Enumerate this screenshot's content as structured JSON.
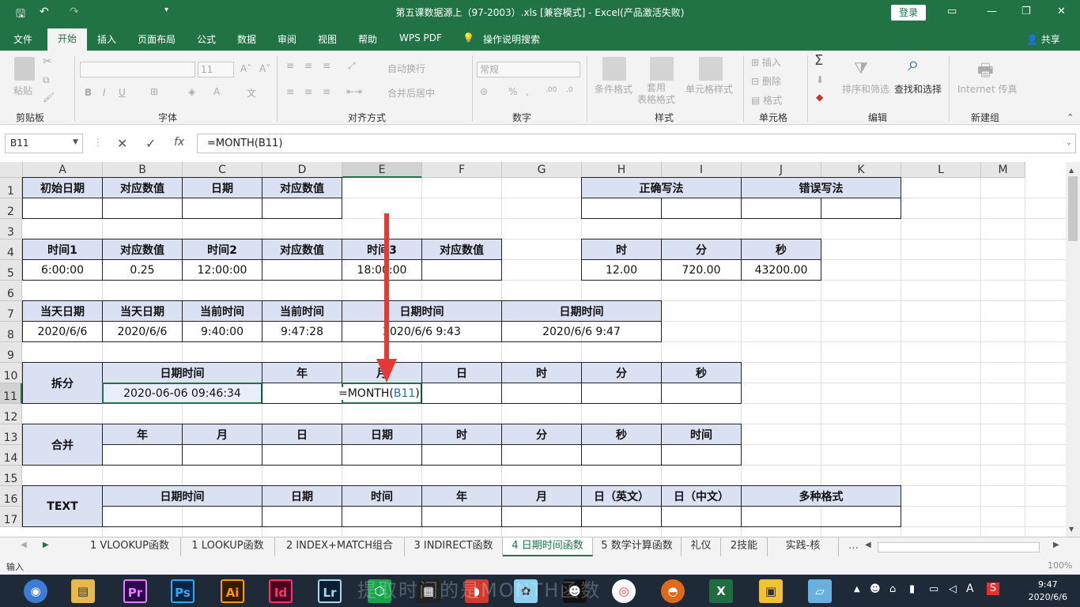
{
  "title_bar": {
    "title": "第五课数据源上（97-2003）.xls  [兼容模式]  -  Excel(产品激活失败)",
    "login": "登录"
  },
  "menu": [
    "文件",
    "开始",
    "插入",
    "页面布局",
    "公式",
    "数据",
    "审阅",
    "视图",
    "帮助",
    "WPS PDF",
    "操作说明搜索",
    "共享"
  ],
  "ribbon": {
    "groups": [
      "剪贴板",
      "字体",
      "对齐方式",
      "数字",
      "样式",
      "单元格",
      "编辑",
      "新建组"
    ],
    "paste": "粘贴",
    "font_size": "11",
    "wrap": "自动换行",
    "merge": "合并后居中",
    "number_format": "常规",
    "cond_format": "条件格式",
    "table_format": "套用\n表格格式",
    "cell_styles": "单元格样式",
    "insert": "插入",
    "delete": "删除",
    "format": "格式",
    "sort_filter": "排序和筛选",
    "find_select": "查找和选择",
    "internet": "Internet 传真"
  },
  "formula_bar": {
    "name_box": "B11",
    "formula": "=MONTH(B11)"
  },
  "columns": [
    "A",
    "B",
    "C",
    "D",
    "E",
    "F",
    "G",
    "H",
    "I",
    "J",
    "K",
    "L",
    "M"
  ],
  "rows": [
    "1",
    "2",
    "3",
    "4",
    "5",
    "6",
    "7",
    "8",
    "9",
    "10",
    "11",
    "12",
    "13",
    "14",
    "15",
    "16",
    "17"
  ],
  "cells": {
    "r1": [
      "初始日期",
      "对应数值",
      "日期",
      "对应数值",
      "正确写法",
      "错误写法"
    ],
    "r4": [
      "时间1",
      "对应数值",
      "时间2",
      "对应数值",
      "时间3",
      "对应数值",
      "时",
      "分",
      "秒"
    ],
    "r5": [
      "6:00:00",
      "0.25",
      "12:00:00",
      "18:00:00",
      "12.00",
      "720.00",
      "43200.00"
    ],
    "r7": [
      "当天日期",
      "当天日期",
      "当前时间",
      "当前时间",
      "日期时间",
      "日期时间"
    ],
    "r8": [
      "2020/6/6",
      "2020/6/6",
      "9:40:00",
      "9:47:28",
      "2020/6/6 9:43",
      "2020/6/6 9:47"
    ],
    "split_label": "拆分",
    "r10": [
      "日期时间",
      "年",
      "月",
      "日",
      "时",
      "分",
      "秒"
    ],
    "r11": [
      "2020-06-06 09:46:34",
      "=MONTH(",
      "B11",
      ")"
    ],
    "merge_label": "合并",
    "r13": [
      "年",
      "月",
      "日",
      "日期",
      "时",
      "分",
      "秒",
      "时间"
    ],
    "text_label": "TEXT",
    "r16": [
      "日期时间",
      "日期",
      "时间",
      "年",
      "月",
      "日（英文）",
      "日（中文）",
      "多种格式"
    ]
  },
  "sheet_tabs": [
    "1 VLOOKUP函数",
    "1 LOOKUP函数",
    "2 INDEX+MATCH组合",
    "3 INDIRECT函数",
    "4 日期时间函数",
    "5 数学计算函数",
    "礼仪",
    "2技能",
    "实践-核"
  ],
  "active_tab": "4 日期时间函数",
  "status": {
    "mode": "输入",
    "zoom": "100%"
  },
  "taskbar": {
    "time": "9:47",
    "date": "2020/6/6"
  },
  "watermark": "提取时间的是MONTH函数"
}
